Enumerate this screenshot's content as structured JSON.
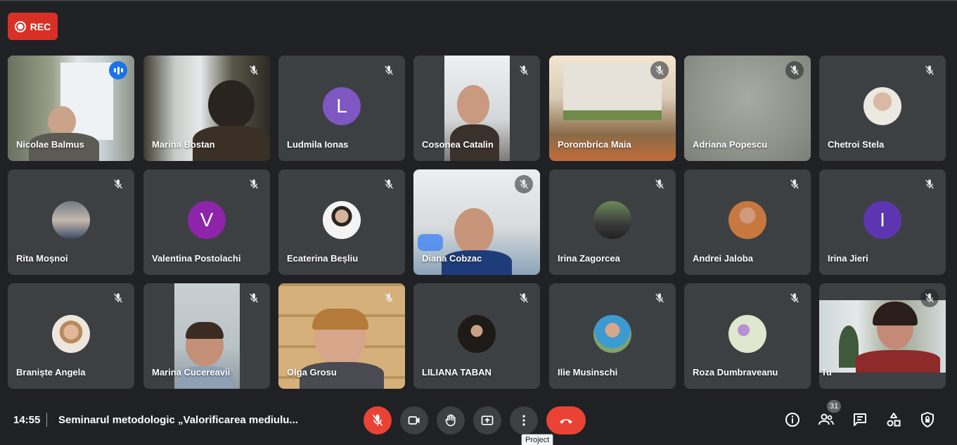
{
  "recording": {
    "label": "REC"
  },
  "participants": [
    {
      "name": "Nicolae Balmus",
      "state": "speaking"
    },
    {
      "name": "Marina Bostan",
      "state": "muted"
    },
    {
      "name": "Ludmila Ionas",
      "state": "muted",
      "initial": "L",
      "color": "#7e57c2"
    },
    {
      "name": "Cosonea Catalin",
      "state": "muted"
    },
    {
      "name": "Porombrica Maia",
      "state": "muted"
    },
    {
      "name": "Adriana Popescu",
      "state": "muted"
    },
    {
      "name": "Chetroi Stela",
      "state": "muted"
    },
    {
      "name": "Rita Moșnoi",
      "state": "muted"
    },
    {
      "name": "Valentina Postolachi",
      "state": "muted",
      "initial": "V",
      "color": "#8e24aa"
    },
    {
      "name": "Ecaterina Beșliu",
      "state": "muted"
    },
    {
      "name": "Diana Cobzac",
      "state": "muted"
    },
    {
      "name": "Irina Zagorcea",
      "state": "muted"
    },
    {
      "name": "Andrei Jaloba",
      "state": "muted"
    },
    {
      "name": "Irina Jieri",
      "state": "muted",
      "initial": "I",
      "color": "#5e35b1"
    },
    {
      "name": "Braniște Angela",
      "state": "muted"
    },
    {
      "name": "Marina Cucereavii",
      "state": "muted"
    },
    {
      "name": "Olga Grosu",
      "state": "muted"
    },
    {
      "name": "LILIANA TABAN",
      "state": "muted"
    },
    {
      "name": "Ilie Musinschi",
      "state": "muted"
    },
    {
      "name": "Roza Dumbraveanu",
      "state": "muted"
    },
    {
      "name": "Tu",
      "state": "muted"
    }
  ],
  "bottom_bar": {
    "time": "14:55",
    "meeting_title": "Seminarul metodologic „Valorificarea mediulu...",
    "tooltip": "Project",
    "participant_count": "31",
    "controls": [
      "mic-off-icon",
      "camera-icon",
      "raise-hand-icon",
      "present-screen-icon",
      "more-options-icon",
      "hang-up-icon"
    ],
    "right_controls": [
      "info-icon",
      "people-icon",
      "chat-icon",
      "activities-icon",
      "host-controls-icon"
    ]
  },
  "colors": {
    "background": "#202124",
    "tile": "#3c4043",
    "accent_red": "#ea4335",
    "speaking_blue": "#1a73e8"
  }
}
